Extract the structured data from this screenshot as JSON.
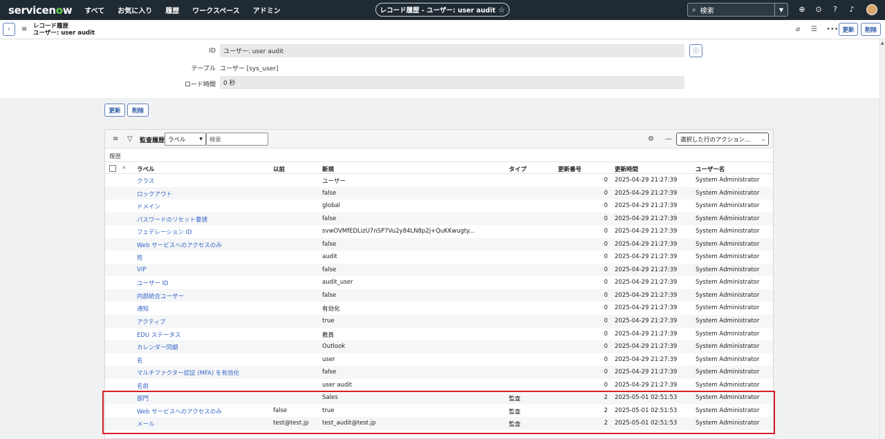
{
  "topnav": {
    "logo": "servicenow",
    "items": [
      "すべて",
      "お気に入り",
      "履歴",
      "ワークスペース",
      "アドミン"
    ],
    "title": "レコード履歴 - ユーザー: user audit",
    "search_label": "検索",
    "icons": [
      "globe-icon",
      "chat-icon",
      "help-icon",
      "bell-icon"
    ]
  },
  "form_header": {
    "title_line1": "レコード履歴",
    "title_line2": "ユーザー: user audit",
    "update_label": "更新",
    "delete_label": "削除"
  },
  "form": {
    "id_label": "ID",
    "id_value": "ユーザー: user audit",
    "table_label": "テーブル",
    "table_value": "ユーザー [sys_user]",
    "load_label": "ロード時間",
    "load_value": "0 秒"
  },
  "form_buttons": {
    "update_label": "更新",
    "delete_label": "削除"
  },
  "list": {
    "title": "監査履歴",
    "filter_select": "ラベル",
    "search_placeholder": "検索",
    "action_select": "選択した行のアクション...",
    "breadcrumb": "履歴",
    "columns": [
      "ラベル",
      "以前",
      "新規",
      "タイプ",
      "更新番号",
      "更新時間",
      "ユーザー名"
    ],
    "rows": [
      {
        "label": "クラス",
        "old": "",
        "new": "ユーザー",
        "type": "",
        "num": "0",
        "time": "2025-04-29 21:27:39",
        "user": "System Administrator"
      },
      {
        "label": "ロックアウト",
        "old": "",
        "new": "false",
        "type": "",
        "num": "0",
        "time": "2025-04-29 21:27:39",
        "user": "System Administrator"
      },
      {
        "label": "ドメイン",
        "old": "",
        "new": "global",
        "type": "",
        "num": "0",
        "time": "2025-04-29 21:27:39",
        "user": "System Administrator"
      },
      {
        "label": "パスワードのリセット要請",
        "old": "",
        "new": "false",
        "type": "",
        "num": "0",
        "time": "2025-04-29 21:27:39",
        "user": "System Administrator"
      },
      {
        "label": "フェデレーション ID",
        "old": "",
        "new": "svwOVMfEDLizU7nSP7Vu2y84LN8p2j+QuKKwugty...",
        "type": "",
        "num": "0",
        "time": "2025-04-29 21:27:39",
        "user": "System Administrator"
      },
      {
        "label": "Web サービスへのアクセスのみ",
        "old": "",
        "new": "false",
        "type": "",
        "num": "0",
        "time": "2025-04-29 21:27:39",
        "user": "System Administrator"
      },
      {
        "label": "姓",
        "old": "",
        "new": "audit",
        "type": "",
        "num": "0",
        "time": "2025-04-29 21:27:39",
        "user": "System Administrator"
      },
      {
        "label": "VIP",
        "old": "",
        "new": "false",
        "type": "",
        "num": "0",
        "time": "2025-04-29 21:27:39",
        "user": "System Administrator"
      },
      {
        "label": "ユーザー ID",
        "old": "",
        "new": "audit_user",
        "type": "",
        "num": "0",
        "time": "2025-04-29 21:27:39",
        "user": "System Administrator"
      },
      {
        "label": "内部統合ユーザー",
        "old": "",
        "new": "false",
        "type": "",
        "num": "0",
        "time": "2025-04-29 21:27:39",
        "user": "System Administrator"
      },
      {
        "label": "通知",
        "old": "",
        "new": "有効化",
        "type": "",
        "num": "0",
        "time": "2025-04-29 21:27:39",
        "user": "System Administrator"
      },
      {
        "label": "アクティブ",
        "old": "",
        "new": "true",
        "type": "",
        "num": "0",
        "time": "2025-04-29 21:27:39",
        "user": "System Administrator"
      },
      {
        "label": "EDU ステータス",
        "old": "",
        "new": "教員",
        "type": "",
        "num": "0",
        "time": "2025-04-29 21:27:39",
        "user": "System Administrator"
      },
      {
        "label": "カレンダー同期",
        "old": "",
        "new": "Outlook",
        "type": "",
        "num": "0",
        "time": "2025-04-29 21:27:39",
        "user": "System Administrator"
      },
      {
        "label": "名",
        "old": "",
        "new": "user",
        "type": "",
        "num": "0",
        "time": "2025-04-29 21:27:39",
        "user": "System Administrator"
      },
      {
        "label": "マルチファクター認証 (MFA) を有効化",
        "old": "",
        "new": "false",
        "type": "",
        "num": "0",
        "time": "2025-04-29 21:27:39",
        "user": "System Administrator"
      },
      {
        "label": "名前",
        "old": "",
        "new": "user audit",
        "type": "",
        "num": "0",
        "time": "2025-04-29 21:27:39",
        "user": "System Administrator"
      },
      {
        "label": "部門",
        "old": "",
        "new": "Sales",
        "type": "監査",
        "num": "2",
        "time": "2025-05-01 02:51:53",
        "user": "System Administrator"
      },
      {
        "label": "Web サービスへのアクセスのみ",
        "old": "false",
        "new": "true",
        "type": "監査",
        "num": "2",
        "time": "2025-05-01 02:51:53",
        "user": "System Administrator"
      },
      {
        "label": "メール",
        "old": "test@test.jp",
        "new": "test_audit@test.jp",
        "type": "監査",
        "num": "2",
        "time": "2025-05-01 02:51:53",
        "user": "System Administrator"
      }
    ]
  },
  "colors": {
    "nav_bg": "#1f2a33",
    "link": "#3866c6",
    "highlight": "#d61f26",
    "logo_accent": "#62d84e"
  }
}
